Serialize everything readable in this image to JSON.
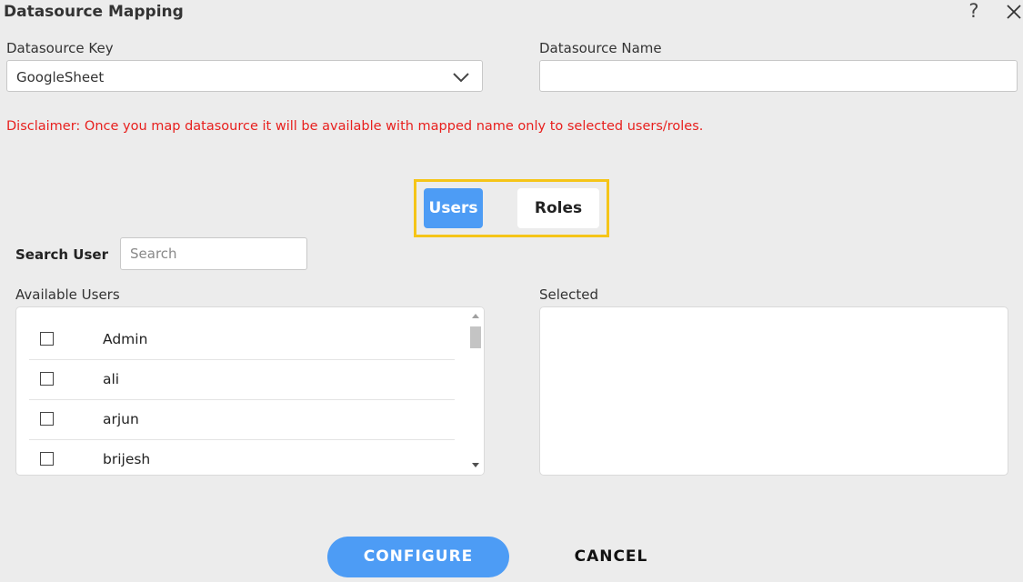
{
  "dialog": {
    "title": "Datasource Mapping",
    "help_glyph": "?"
  },
  "datasource_key": {
    "label": "Datasource Key",
    "value": "GoogleSheet"
  },
  "datasource_name": {
    "label": "Datasource Name",
    "value": ""
  },
  "disclaimer": "Disclaimer: Once you map datasource it will be available with mapped name only to selected users/roles.",
  "tabs": {
    "users": "Users",
    "roles": "Roles",
    "active": "Users"
  },
  "search": {
    "label": "Search User",
    "placeholder": "Search"
  },
  "available": {
    "label": "Available Users",
    "items": [
      {
        "name": "Admin",
        "checked": false
      },
      {
        "name": "ali",
        "checked": false
      },
      {
        "name": "arjun",
        "checked": false
      },
      {
        "name": "brijesh",
        "checked": false
      }
    ]
  },
  "selected": {
    "label": "Selected",
    "items": []
  },
  "buttons": {
    "configure": "CONFIGURE",
    "cancel": "CANCEL"
  },
  "colors": {
    "accent": "#4d9cf5",
    "highlight_frame": "#f5c518",
    "disclaimer": "#e8201e"
  },
  "icons": [
    "help-icon",
    "close-icon",
    "chevron-down-icon"
  ]
}
